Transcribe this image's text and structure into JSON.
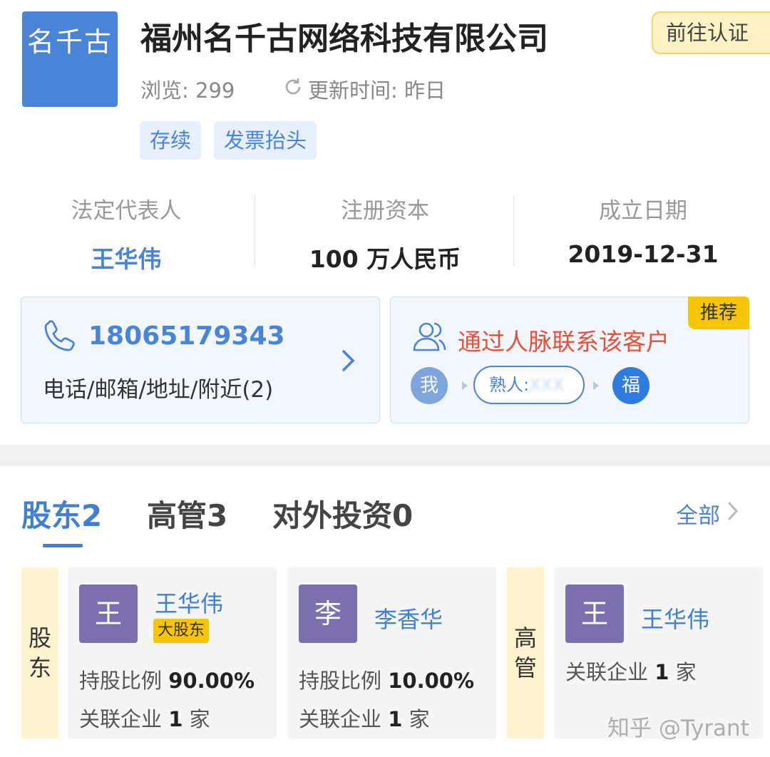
{
  "company": {
    "logo_text": "名千古",
    "name": "福州名千古网络科技有限公司",
    "views_label": "浏览: 299",
    "update_label": "更新时间: 昨日",
    "verify_button": "前往认证",
    "tags": [
      "存续",
      "发票抬头"
    ]
  },
  "stats": [
    {
      "label": "法定代表人",
      "value": "王华伟"
    },
    {
      "label": "注册资本",
      "value": "100 万人民币"
    },
    {
      "label": "成立日期",
      "value": "2019-12-31"
    }
  ],
  "contact": {
    "phone": "18065179343",
    "subtitle": "电话/邮箱/地址/附近(2)"
  },
  "recommend": {
    "badge": "推荐",
    "title": "通过人脉联系该客户",
    "me": "我",
    "acquaintance_label": "熟人:",
    "acquaintance_value": "XXX",
    "target": "福"
  },
  "tabs": [
    {
      "label": "股东2"
    },
    {
      "label": "高管3"
    },
    {
      "label": "对外投资0"
    }
  ],
  "all_link": "全部",
  "shareholders": {
    "side_label": "股东",
    "items": [
      {
        "avatar": "王",
        "name": "王华伟",
        "badge": "大股东",
        "ratio_label": "持股比例",
        "ratio": "90.00%",
        "related_label": "关联企业",
        "related_count": "1",
        "related_unit": "家"
      },
      {
        "avatar": "李",
        "name": "李香华",
        "ratio_label": "持股比例",
        "ratio": "10.00%",
        "related_label": "关联企业",
        "related_count": "1",
        "related_unit": "家"
      }
    ]
  },
  "executives": {
    "side_label": "高管",
    "items": [
      {
        "avatar": "王",
        "name": "王华伟",
        "related_label": "关联企业",
        "related_count": "1",
        "related_unit": "家"
      }
    ]
  },
  "watermark": "知乎 @Tyrant",
  "colors": {
    "brand_blue": "#4a84d8",
    "badge_yellow": "#f8c600",
    "recommend_red": "#e8503a",
    "avatar_purple": "#7b6fae"
  }
}
